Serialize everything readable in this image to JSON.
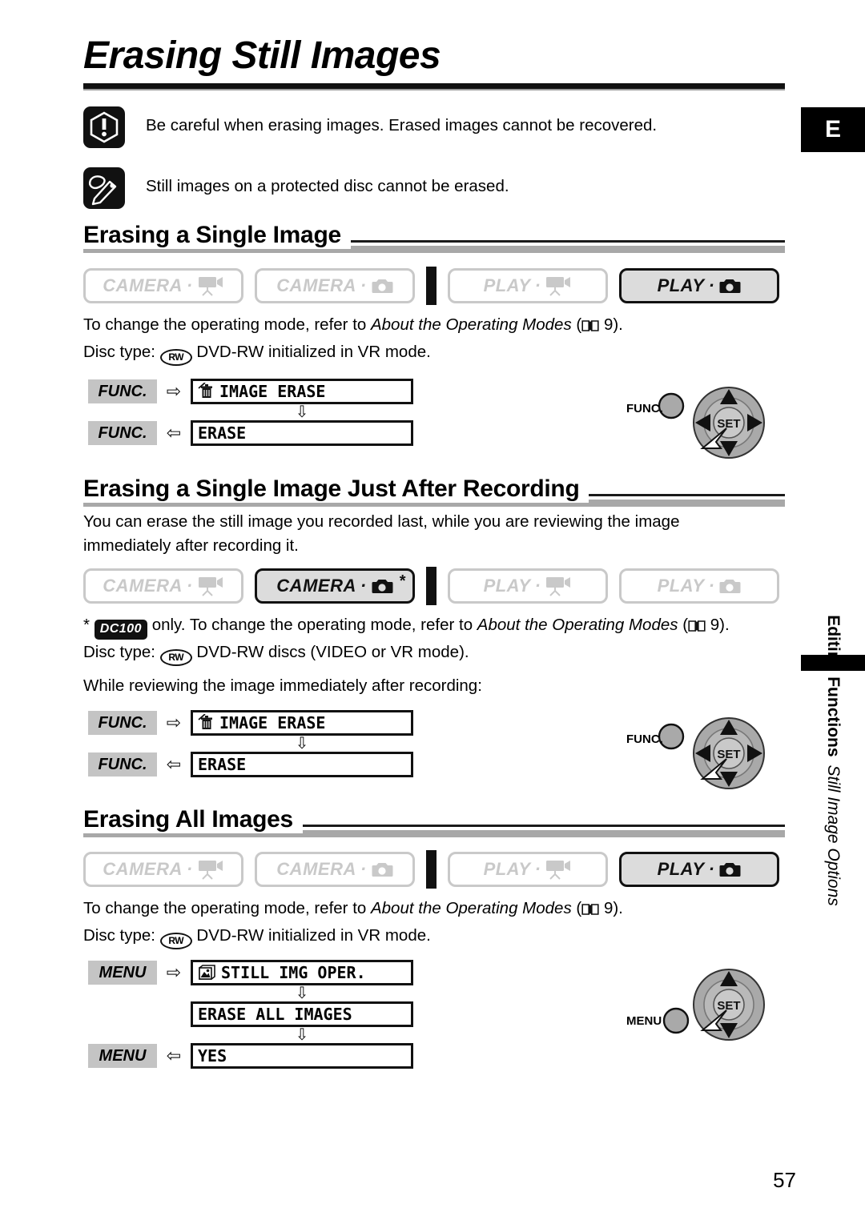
{
  "page": {
    "title": "Erasing Still Images",
    "page_number": "57",
    "corner_tab": "E"
  },
  "notes": [
    {
      "icon": "caution-icon",
      "text": "Be careful when erasing images. Erased images cannot be recovered."
    },
    {
      "icon": "note-pencil-icon",
      "text": "Still images on a protected disc cannot be erased."
    }
  ],
  "sections": [
    {
      "heading": "Erasing a Single Image",
      "modes": [
        {
          "label": "CAMERA",
          "icon": "camcorder-icon",
          "active": false,
          "star": ""
        },
        {
          "label": "CAMERA",
          "icon": "photo-camera-icon",
          "active": false,
          "star": ""
        },
        {
          "label": "PLAY",
          "icon": "camcorder-icon",
          "active": false,
          "star": ""
        },
        {
          "label": "PLAY",
          "icon": "photo-camera-icon",
          "active": true,
          "star": ""
        }
      ],
      "lines": [
        "To change the operating mode, refer to About the Operating Modes (  9).",
        "Disc type:  DVD-RW initialized in VR mode."
      ],
      "flow": {
        "steps": [
          {
            "tag": "FUNC.",
            "arrow": "right",
            "text": "IMAGE ERASE",
            "icon": "trash-erase-icon",
            "indent": false
          },
          {
            "tag": "FUNC.",
            "arrow": "left",
            "text": "ERASE",
            "icon": "",
            "indent": false
          }
        ]
      },
      "control": {
        "button_label": "FUNC.",
        "center_label": "SET",
        "arrows": "four-way"
      }
    },
    {
      "heading": "Erasing a Single Image Just After Recording",
      "intro": [
        "You can erase the still image you recorded last, while you are reviewing the image",
        "immediately after recording it."
      ],
      "modes": [
        {
          "label": "CAMERA",
          "icon": "camcorder-icon",
          "active": false,
          "star": ""
        },
        {
          "label": "CAMERA",
          "icon": "photo-camera-icon",
          "active": true,
          "star": "*"
        },
        {
          "label": "PLAY",
          "icon": "camcorder-icon",
          "active": false,
          "star": ""
        },
        {
          "label": "PLAY",
          "icon": "photo-camera-icon",
          "active": false,
          "star": ""
        }
      ],
      "footnote_badge": "DC100",
      "lines": [
        "only. To change the operating mode, refer to About the Operating Modes (  9).",
        "Disc type:  DVD-RW discs (VIDEO or VR mode).",
        "While reviewing the image immediately after recording:"
      ],
      "flow": {
        "steps": [
          {
            "tag": "FUNC.",
            "arrow": "right",
            "text": "IMAGE ERASE",
            "icon": "trash-erase-icon",
            "indent": false
          },
          {
            "tag": "FUNC.",
            "arrow": "left",
            "text": "ERASE",
            "icon": "",
            "indent": false
          }
        ]
      },
      "control": {
        "button_label": "FUNC.",
        "center_label": "SET",
        "arrows": "four-way"
      }
    },
    {
      "heading": "Erasing All Images",
      "modes": [
        {
          "label": "CAMERA",
          "icon": "camcorder-icon",
          "active": false,
          "star": ""
        },
        {
          "label": "CAMERA",
          "icon": "photo-camera-icon",
          "active": false,
          "star": ""
        },
        {
          "label": "PLAY",
          "icon": "camcorder-icon",
          "active": false,
          "star": ""
        },
        {
          "label": "PLAY",
          "icon": "photo-camera-icon",
          "active": true,
          "star": ""
        }
      ],
      "lines": [
        "To change the operating mode, refer to About the Operating Modes (  9).",
        "Disc type:  DVD-RW initialized in VR mode."
      ],
      "flow": {
        "steps": [
          {
            "tag": "MENU",
            "arrow": "right",
            "text": "STILL IMG OPER.",
            "icon": "photo-stack-icon",
            "indent": false
          },
          {
            "tag": "",
            "arrow": "none",
            "text": "ERASE ALL IMAGES",
            "icon": "",
            "indent": true
          },
          {
            "tag": "MENU",
            "arrow": "left",
            "text": "YES",
            "icon": "",
            "indent": false
          }
        ]
      },
      "control": {
        "button_label": "MENU",
        "center_label": "SET",
        "arrows": "up-down"
      }
    }
  ],
  "sidebar": {
    "title": "Editing Functions",
    "subtitle": "Still Image Options"
  },
  "inline": {
    "rw_label": "RW",
    "page_ref": "9",
    "disc_prefix": "Disc type:",
    "operating_modes_pre": "To change the operating mode, refer to ",
    "operating_modes_em": "About the Operating Modes",
    "operating_modes_post": ")."
  },
  "colors": {
    "rule_gray": "#a8a8a8",
    "mode_inactive": "#c9c9c9",
    "mode_active_bg": "#dcdcdc",
    "tag_bg": "#c4c4c4",
    "black": "#111111"
  }
}
